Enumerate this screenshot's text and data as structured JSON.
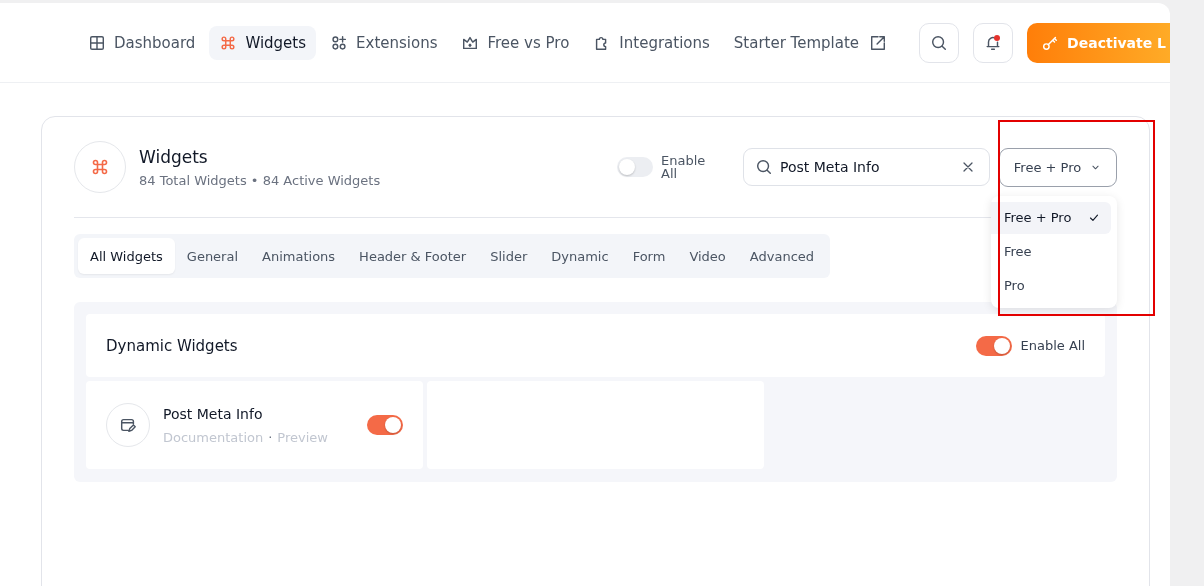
{
  "nav": {
    "items": [
      {
        "label": "Dashboard",
        "selected": false,
        "external": false
      },
      {
        "label": "Widgets",
        "selected": true,
        "external": false
      },
      {
        "label": "Extensions",
        "selected": false,
        "external": false
      },
      {
        "label": "Free vs Pro",
        "selected": false,
        "external": false
      },
      {
        "label": "Integrations",
        "selected": false,
        "external": false
      },
      {
        "label": "Starter Template",
        "selected": false,
        "external": true
      }
    ],
    "notifications": {
      "unread": true
    },
    "deactivate_button": "Deactivate L"
  },
  "card": {
    "title": "Widgets",
    "subtitle": "84 Total Widgets • 84 Active Widgets",
    "enable_all": {
      "label": "Enable All",
      "on": false
    },
    "search": {
      "value": "Post Meta Info"
    },
    "filter": {
      "value": "Free + Pro",
      "expanded": true,
      "options": [
        {
          "label": "Free + Pro",
          "selected": true
        },
        {
          "label": "Free",
          "selected": false
        },
        {
          "label": "Pro",
          "selected": false
        }
      ]
    },
    "tabs": [
      {
        "label": "All Widgets",
        "selected": true
      },
      {
        "label": "General",
        "selected": false
      },
      {
        "label": "Animations",
        "selected": false
      },
      {
        "label": "Header & Footer",
        "selected": false
      },
      {
        "label": "Slider",
        "selected": false
      },
      {
        "label": "Dynamic",
        "selected": false
      },
      {
        "label": "Form",
        "selected": false
      },
      {
        "label": "Video",
        "selected": false
      },
      {
        "label": "Advanced",
        "selected": false
      }
    ],
    "section": {
      "title": "Dynamic Widgets",
      "enable_all": {
        "label": "Enable All",
        "on": true
      },
      "widgets": [
        {
          "name": "Post Meta Info",
          "links": [
            "Documentation",
            "Preview"
          ],
          "link_separator": "·",
          "on": true
        }
      ]
    }
  }
}
